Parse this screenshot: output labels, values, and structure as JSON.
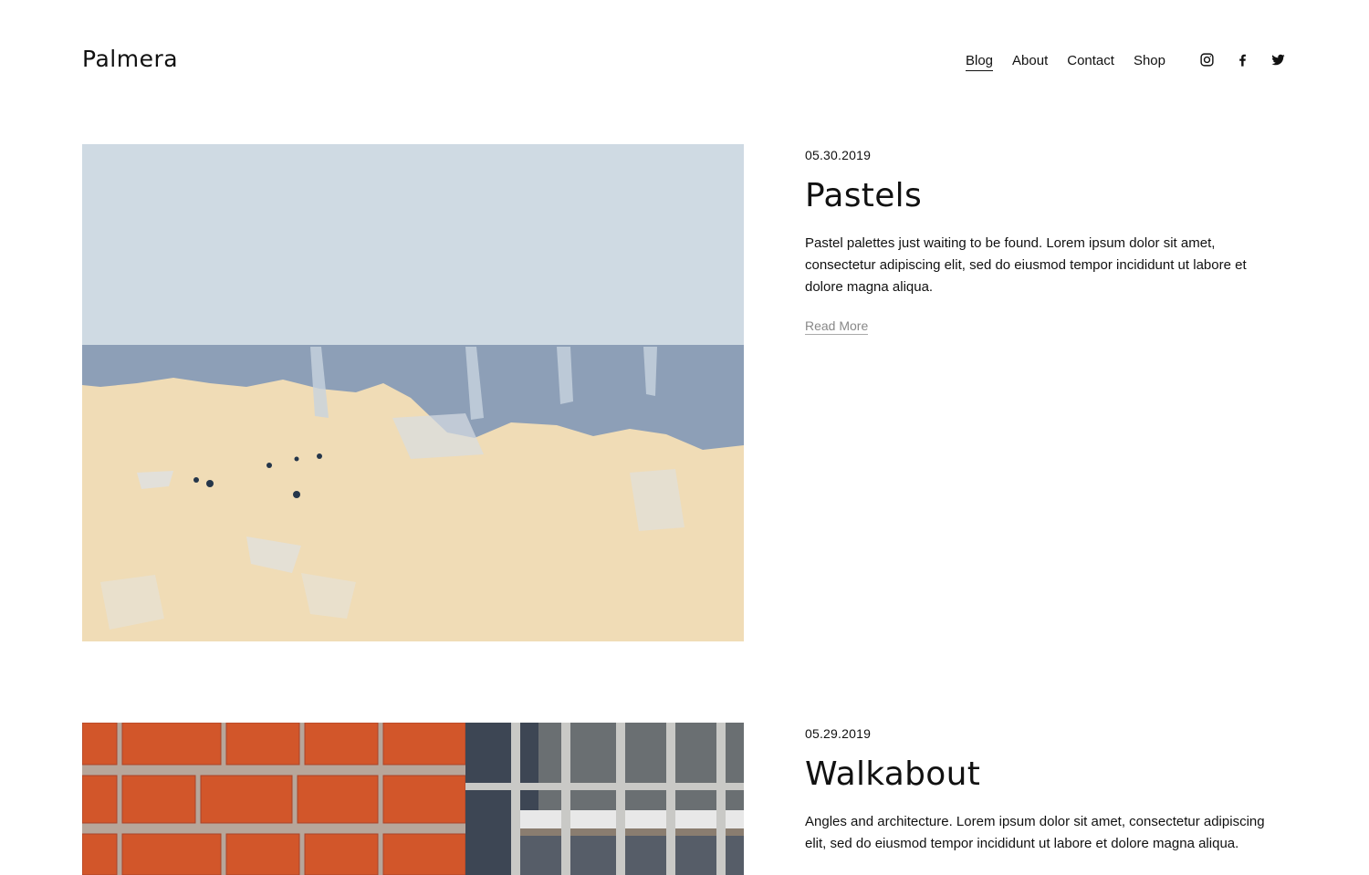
{
  "site": {
    "title": "Palmera"
  },
  "nav": {
    "items": [
      {
        "label": "Blog",
        "active": true
      },
      {
        "label": "About"
      },
      {
        "label": "Contact"
      },
      {
        "label": "Shop"
      }
    ],
    "social": [
      {
        "icon": "instagram-icon"
      },
      {
        "icon": "facebook-icon"
      },
      {
        "icon": "twitter-icon"
      }
    ]
  },
  "posts": [
    {
      "date": "05.30.2019",
      "title": "Pastels",
      "excerpt": "Pastel palettes just waiting to be found. Lorem ipsum dolor sit amet, consectetur adipiscing elit, sed do eiusmod tempor incididunt ut labore et dolore magna aliqua.",
      "read_more": "Read More"
    },
    {
      "date": "05.29.2019",
      "title": "Walkabout",
      "excerpt": "Angles and architecture. Lorem ipsum dolor sit amet, consectetur adipiscing elit, sed do eiusmod tempor incididunt ut labore et dolore magna aliqua."
    }
  ],
  "colors": {
    "text": "#111111",
    "muted": "#888888",
    "sky": "#cfdae3",
    "wall_blue": "#8d9fb7",
    "wall_cream": "#f0dcb6",
    "brick": "#d2562a"
  }
}
